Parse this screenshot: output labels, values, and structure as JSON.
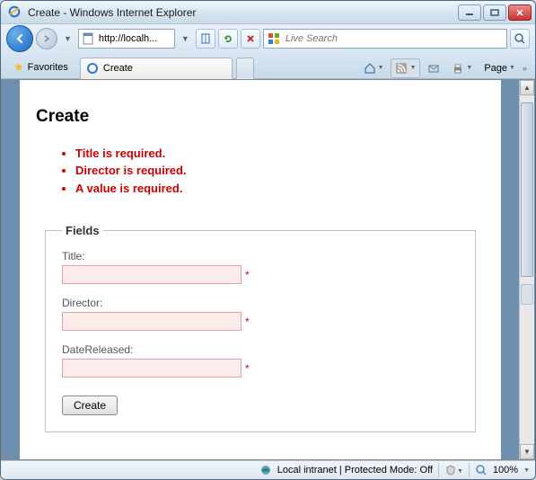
{
  "window": {
    "title": "Create - Windows Internet Explorer"
  },
  "nav": {
    "address": "http://localh...",
    "search_placeholder": "Live Search"
  },
  "tabs": {
    "favorites_label": "Favorites",
    "active_tab": "Create"
  },
  "commandbar": {
    "page_label": "Page"
  },
  "page": {
    "heading": "Create",
    "errors": [
      "Title is required.",
      "Director is required.",
      "A value is required."
    ],
    "fieldset_legend": "Fields",
    "fields": {
      "title_label": "Title:",
      "title_value": "",
      "director_label": "Director:",
      "director_value": "",
      "date_label": "DateReleased:",
      "date_value": ""
    },
    "submit_label": "Create"
  },
  "status": {
    "zone_text": "Local intranet | Protected Mode: Off",
    "zoom": "100%"
  }
}
